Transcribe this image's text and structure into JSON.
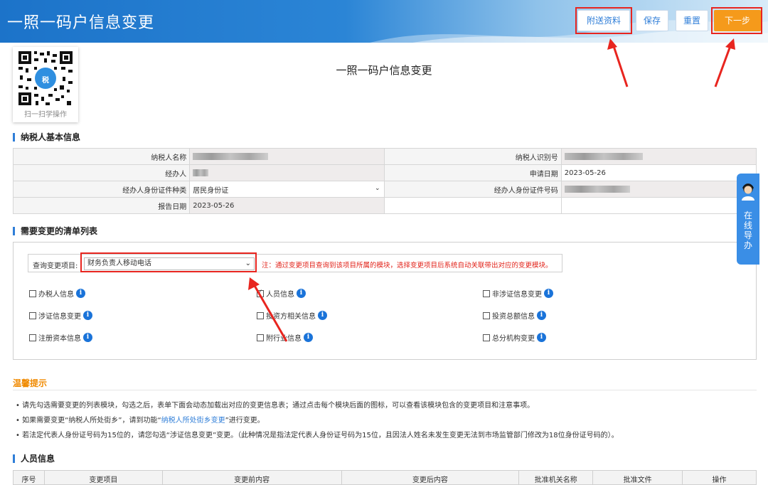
{
  "header": {
    "title": "一照一码户信息变更",
    "buttons": {
      "attach": "附送资料",
      "save": "保存",
      "reset": "重置",
      "next": "下一步"
    }
  },
  "qr": {
    "caption": "扫一扫学操作",
    "badge": "税"
  },
  "page_title": "一照一码户信息变更",
  "basic_info": {
    "section_title": "纳税人基本信息",
    "rows": [
      {
        "l1": "纳税人名称",
        "v1": "",
        "l2": "纳税人识别号",
        "v2": ""
      },
      {
        "l1": "经办人",
        "v1": "",
        "l2": "申请日期",
        "v2": "2023-05-26"
      },
      {
        "l1": "经办人身份证件种类",
        "v1": "居民身份证",
        "l2": "经办人身份证件号码",
        "v2": ""
      },
      {
        "l1": "报告日期",
        "v1": "2023-05-26",
        "l2": "",
        "v2": ""
      }
    ]
  },
  "change_list": {
    "section_title": "需要变更的清单列表",
    "query_label": "查询变更项目:",
    "query_value": "财务负责人移动电话",
    "note": "注：通过变更项目查询到该项目所属的模块，选择变更项目后系统自动关联带出对应的变更模块。",
    "options": [
      {
        "label": "办税人信息",
        "checked": false
      },
      {
        "label": "人员信息",
        "checked": true
      },
      {
        "label": "非涉证信息变更",
        "checked": false
      },
      {
        "label": "涉证信息变更",
        "checked": false
      },
      {
        "label": "投资方相关信息",
        "checked": false
      },
      {
        "label": "投资总额信息",
        "checked": false
      },
      {
        "label": "注册资本信息",
        "checked": false
      },
      {
        "label": "附行业信息",
        "checked": false
      },
      {
        "label": "总分机构变更",
        "checked": false
      }
    ]
  },
  "tips": {
    "title": "温馨提示",
    "line1": "请先勾选需要变更的列表模块，勾选之后，表单下面会动态加载出对应的变更信息表；通过点击每个模块后面的图标，可以查看该模块包含的变更项目和注意事项。",
    "line2_pre": "如果需要变更“纳税人所处街乡”，请到功能“",
    "line2_link": "纳税人所处街乡变更",
    "line2_post": "”进行变更。",
    "line3": "若法定代表人身份证号码为15位的，请您勾选“涉证信息变更”变更。（此种情况是指法定代表人身份证号码为15位，且因法人姓名未发生变更无法到市场监管部门修改为18位身份证号码的）。"
  },
  "people": {
    "section_title": "人员信息",
    "columns": [
      "序号",
      "变更项目",
      "变更前内容",
      "变更后内容",
      "批准机关名称",
      "批准文件",
      "操作"
    ]
  },
  "online_help": {
    "label": "在线导办"
  },
  "colors": {
    "accent": "#2f7ed8",
    "orange": "#f59a1b",
    "highlight": "#e8251f"
  }
}
